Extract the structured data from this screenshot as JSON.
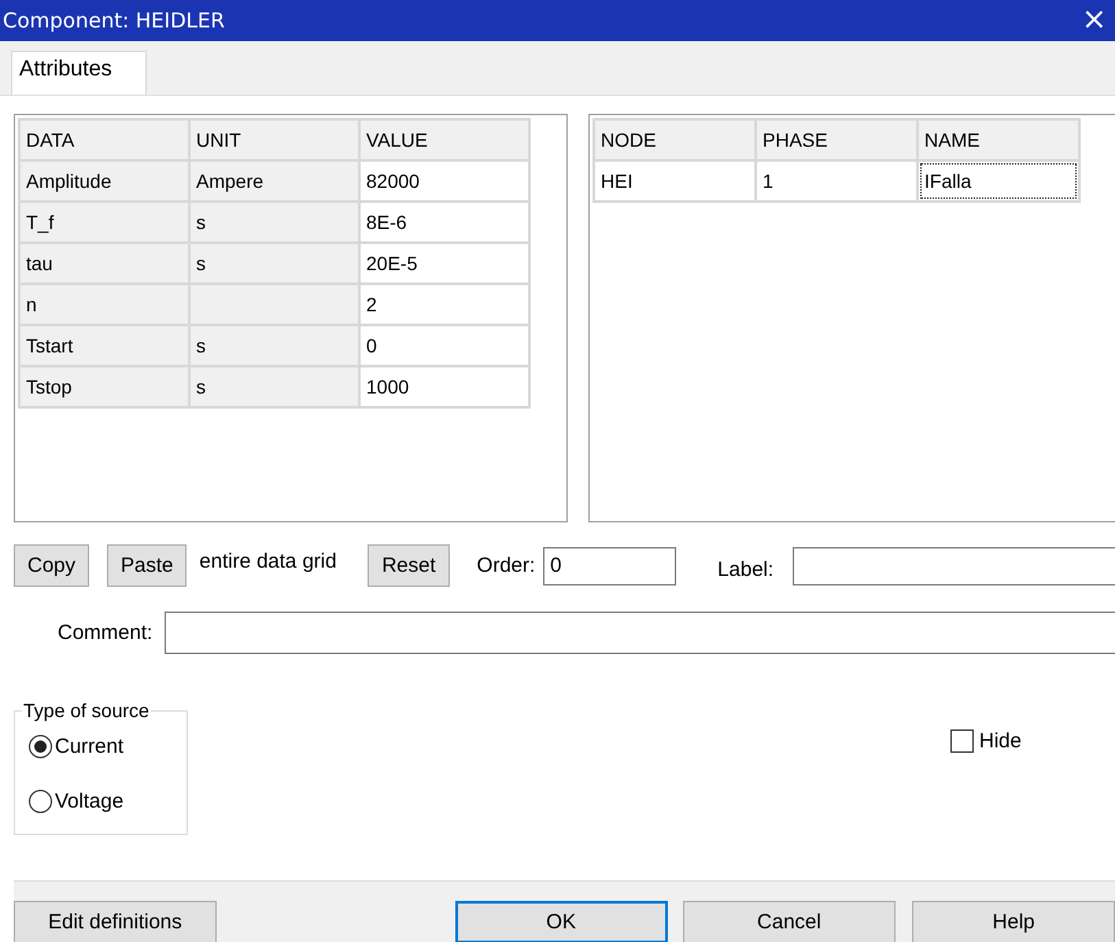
{
  "window": {
    "title": "Component: HEIDLER",
    "close": "×"
  },
  "tabs": [
    {
      "label": "Attributes",
      "selected": true
    }
  ],
  "data_grid": {
    "columns": [
      "DATA",
      "UNIT",
      "VALUE"
    ],
    "rows": [
      {
        "data": "Amplitude",
        "unit": "Ampere",
        "value": "82000"
      },
      {
        "data": "T_f",
        "unit": "s",
        "value": "8E-6"
      },
      {
        "data": "tau",
        "unit": "s",
        "value": "20E-5"
      },
      {
        "data": "n",
        "value": "2"
      },
      {
        "data": "Tstart",
        "unit": "s",
        "value": "0"
      },
      {
        "data": "Tstop",
        "unit": "s",
        "value": "1000"
      }
    ]
  },
  "node_grid": {
    "columns": [
      "NODE",
      "PHASE",
      "NAME"
    ],
    "rows": [
      {
        "cells": [
          {
            "text": "HEI",
            "focused": false
          },
          {
            "text": "1",
            "focused": false
          },
          {
            "text": "IFalla",
            "focused": true
          }
        ]
      }
    ]
  },
  "grid_actions": {
    "copy": "Copy",
    "paste": "Paste",
    "note": "entire data grid",
    "reset": "Reset"
  },
  "order": {
    "label": "Order:",
    "value": "0"
  },
  "label_field": {
    "label": "Label:"
  },
  "comment": {
    "label": "Comment:"
  },
  "source_type": {
    "title": "Type of source",
    "options": [
      {
        "label": "Current",
        "selected": true
      },
      {
        "label": "Voltage",
        "selected": false
      }
    ]
  },
  "hide": {
    "label": "Hide",
    "checked": false
  },
  "footer_buttons": [
    {
      "label": "Edit definitions",
      "default": false
    },
    {
      "label": "OK",
      "default": true
    },
    {
      "label": "Cancel",
      "default": false
    },
    {
      "label": "Help",
      "default": false
    }
  ]
}
